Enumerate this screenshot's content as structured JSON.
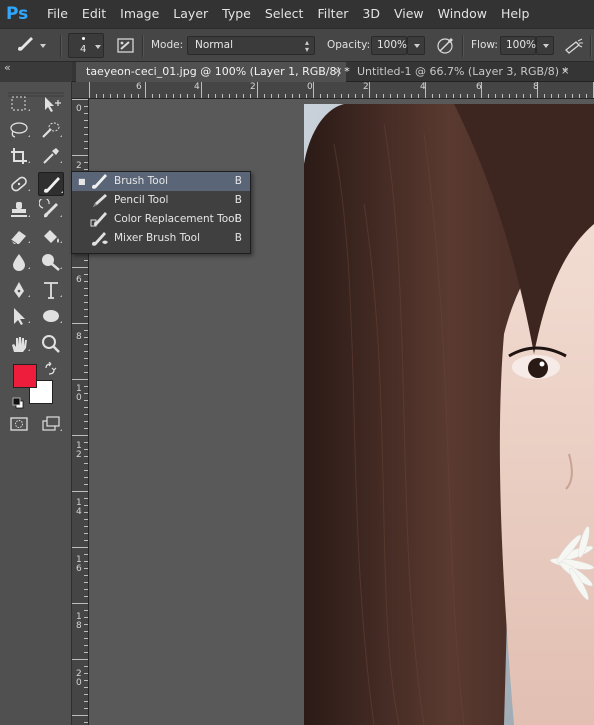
{
  "app": {
    "logo_text": "Ps"
  },
  "menu": [
    "File",
    "Edit",
    "Image",
    "Layer",
    "Type",
    "Select",
    "Filter",
    "3D",
    "View",
    "Window",
    "Help"
  ],
  "options_bar": {
    "brush_size": "4",
    "mode_label": "Mode:",
    "mode_value": "Normal",
    "opacity_label": "Opacity:",
    "opacity_value": "100%",
    "flow_label": "Flow:",
    "flow_value": "100%"
  },
  "tabs": [
    {
      "title": "taeyeon-ceci_01.jpg @ 100% (Layer 1, RGB/8) *",
      "close": "×",
      "active": true
    },
    {
      "title": "Untitled-1 @ 66.7% (Layer 3, RGB/8) *",
      "close": "×",
      "active": false
    }
  ],
  "toolbar": {
    "collapse_glyph": "«",
    "foreground_color": "#ee1d3c",
    "background_color": "#ffffff"
  },
  "ruler_top_labels": [
    "6",
    "4",
    "2",
    "0",
    "2",
    "4",
    "6",
    "8"
  ],
  "ruler_left_labels": [
    "0",
    "2",
    "4",
    "6",
    "8",
    "1\n0",
    "1\n2",
    "1\n4",
    "1\n6",
    "1\n8",
    "2\n0"
  ],
  "tool_flyout": {
    "bullet": "■",
    "items": [
      {
        "label": "Brush Tool",
        "shortcut": "B",
        "selected": true,
        "icon": "brush-icon"
      },
      {
        "label": "Pencil Tool",
        "shortcut": "B",
        "selected": false,
        "icon": "pencil-icon"
      },
      {
        "label": "Color Replacement Tool",
        "shortcut": "B",
        "selected": false,
        "icon": "color-replacement-icon"
      },
      {
        "label": "Mixer Brush Tool",
        "shortcut": "B",
        "selected": false,
        "icon": "mixer-brush-icon"
      }
    ]
  },
  "colors": {
    "menubar": "#333333",
    "panel": "#505050",
    "accent_selection": "#5a6578"
  }
}
